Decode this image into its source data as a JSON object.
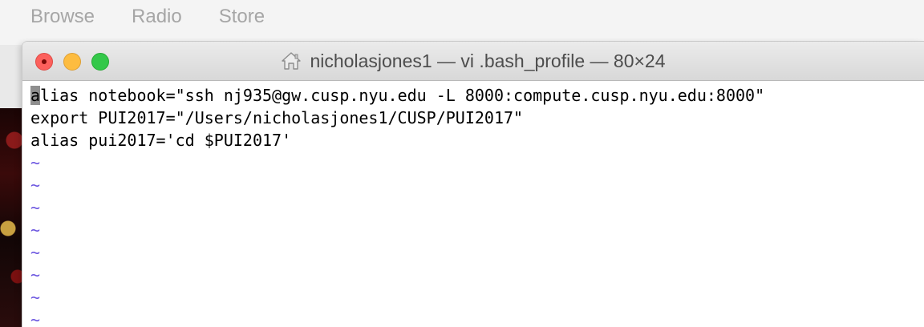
{
  "background_app": {
    "tabs": [
      "Browse",
      "Radio",
      "Store"
    ]
  },
  "terminal": {
    "title": "nicholasjones1 — vi .bash_profile — 80×24",
    "icon": "home-icon",
    "cursor_char": "a",
    "lines": [
      "lias notebook=\"ssh nj935@gw.cusp.nyu.edu -L 8000:compute.cusp.nyu.edu:8000\"",
      "export PUI2017=\"/Users/nicholasjones1/CUSP/PUI2017\"",
      "alias pui2017='cd $PUI2017'"
    ],
    "tilde": "~",
    "tilde_count": 8
  },
  "colors": {
    "close": "#fc605c",
    "minimize": "#fdbc40",
    "maximize": "#34c84a",
    "tilde": "#6b55e0"
  }
}
